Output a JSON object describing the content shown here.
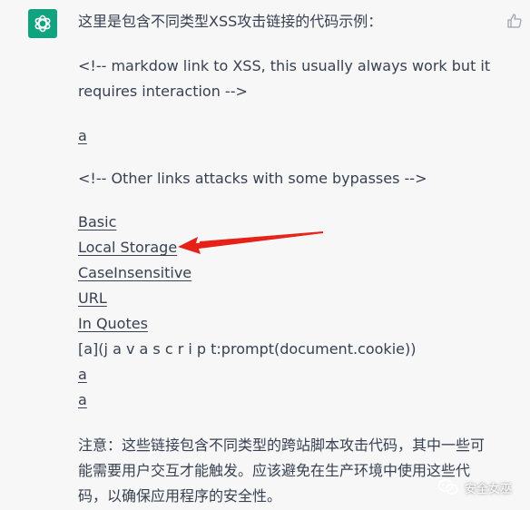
{
  "intro": "这里是包含不同类型XSS攻击链接的代码示例：",
  "comment1_line1": "<!-- markdow link to XSS, this usually always work but it",
  "comment1_line2": "requires interaction -->",
  "link_a_1": "a",
  "comment2": "<!-- Other links attacks with some bypasses -->",
  "links": [
    "Basic",
    "Local Storage",
    "CaseInsensitive",
    "URL",
    "In Quotes"
  ],
  "plain_line": "[a](j a v a s c r i p t:prompt(document.cookie))",
  "link_a_2": "a",
  "link_a_3": "a",
  "note_line1": "注意：这些链接包含不同类型的跨站脚本攻击代码，其中一些可",
  "note_line2": "能需要用户交互才能触发。应该避免在生产环境中使用这些代",
  "note_line3": "码，以确保应用程序的安全性。",
  "watermark": "安全女巫",
  "colors": {
    "background": "#f7f7f8",
    "avatar": "#10a37f",
    "text": "#374151",
    "arrow": "#e62117"
  },
  "icons": [
    "openai-logo-icon",
    "thumbs-up-icon",
    "red-arrow-annotation",
    "wechat-icon"
  ]
}
